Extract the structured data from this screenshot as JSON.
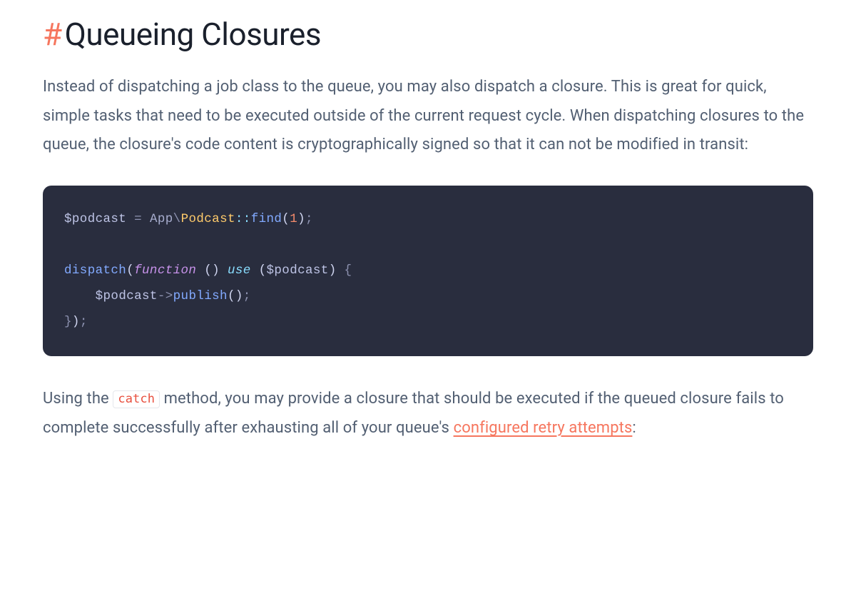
{
  "heading": {
    "hash": "#",
    "title": "Queueing Closures"
  },
  "paragraph1": "Instead of dispatching a job class to the queue, you may also dispatch a closure. This is great for quick, simple tasks that need to be executed outside of the current request cycle. When dispatching closures to the queue, the closure's code content is cryptographically signed so that it can not be modified in transit:",
  "code": {
    "line1": {
      "var": "$podcast",
      "eq": " = ",
      "ns": "App",
      "bslash": "\\",
      "class": "Podcast",
      "scope": "::",
      "fn": "find",
      "open": "(",
      "num": "1",
      "close": ")",
      "semi": ";"
    },
    "line3": {
      "fn": "dispatch",
      "open": "(",
      "kw_function": "function",
      "space1": " ",
      "innerOpen": "(",
      "innerClose": ")",
      "space2": " ",
      "kw_use": "use",
      "space3": " ",
      "useOpen": "(",
      "var": "$podcast",
      "useClose": ")",
      "space4": " ",
      "brace": "{"
    },
    "line4": {
      "indent": "    ",
      "var": "$podcast",
      "arrow": "->",
      "fn": "publish",
      "open": "(",
      "close": ")",
      "semi": ";"
    },
    "line5": {
      "brace": "}",
      "close": ")",
      "semi": ";"
    }
  },
  "paragraph2": {
    "t1": "Using the ",
    "code": "catch",
    "t2": " method, you may provide a closure that should be executed if the queued closure fails to complete successfully after exhausting all of your queue's ",
    "link": "configured retry attempts",
    "t3": ":"
  }
}
